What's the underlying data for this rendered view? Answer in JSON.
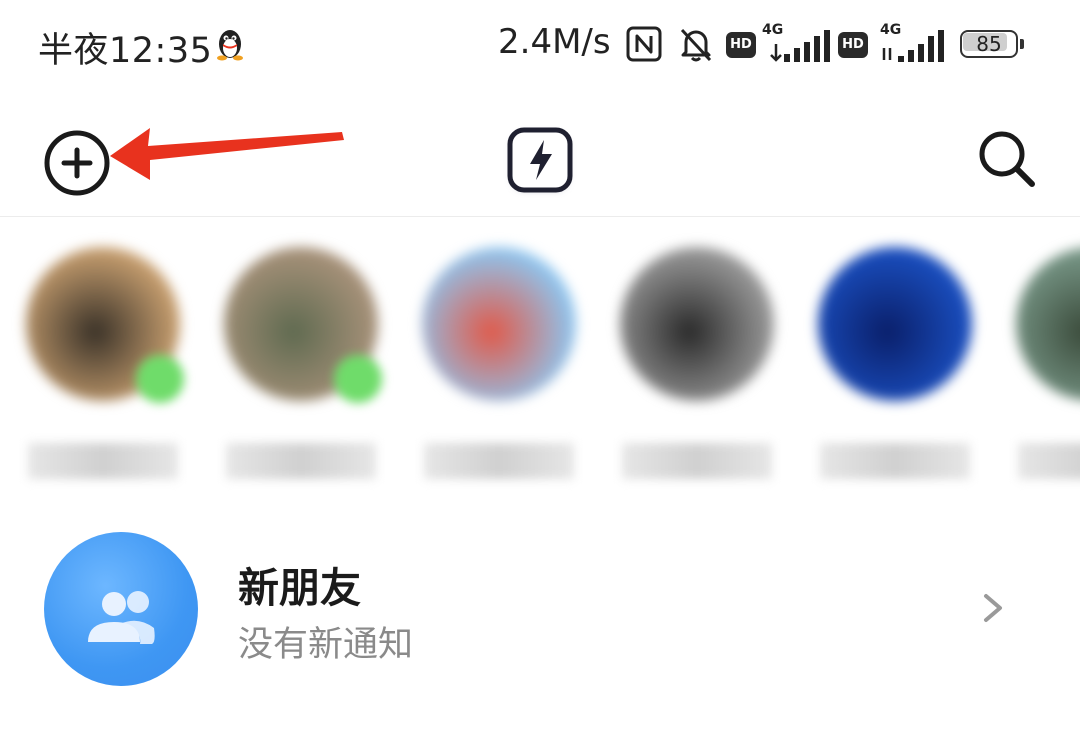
{
  "status_bar": {
    "time": "半夜12:35",
    "net_speed": "2.4M/s",
    "hd_label_1": "HD",
    "network_1": "4G",
    "hd_label_2": "HD",
    "network_2": "4G",
    "battery": "85",
    "battery_level": 0.85,
    "icons": [
      "qq-icon",
      "nfc-icon",
      "bell-muted-icon",
      "signal-icon",
      "battery-icon"
    ]
  },
  "top_bar": {
    "icons": [
      "add-circle-icon",
      "flash-icon",
      "search-icon"
    ],
    "annotation_color": "#e8321e"
  },
  "recent_contacts": [
    {
      "avatar_colors": [
        "#c9a070",
        "#3a3228"
      ],
      "online": true
    },
    {
      "avatar_colors": [
        "#a8927a",
        "#5f6a50"
      ],
      "online": true
    },
    {
      "avatar_colors": [
        "#8ec6f0",
        "#e05a4a"
      ],
      "online": false
    },
    {
      "avatar_colors": [
        "#9a9a9a",
        "#2a2a2a"
      ],
      "online": false
    },
    {
      "avatar_colors": [
        "#1a4fc0",
        "#0a1f6a"
      ],
      "online": false
    },
    {
      "avatar_colors": [
        "#7a9a8a",
        "#3a4a3a"
      ],
      "online": false
    }
  ],
  "new_friends": {
    "title": "新朋友",
    "subtitle": "没有新通知",
    "icon": "people-icon",
    "accent": "#3f97f3"
  }
}
